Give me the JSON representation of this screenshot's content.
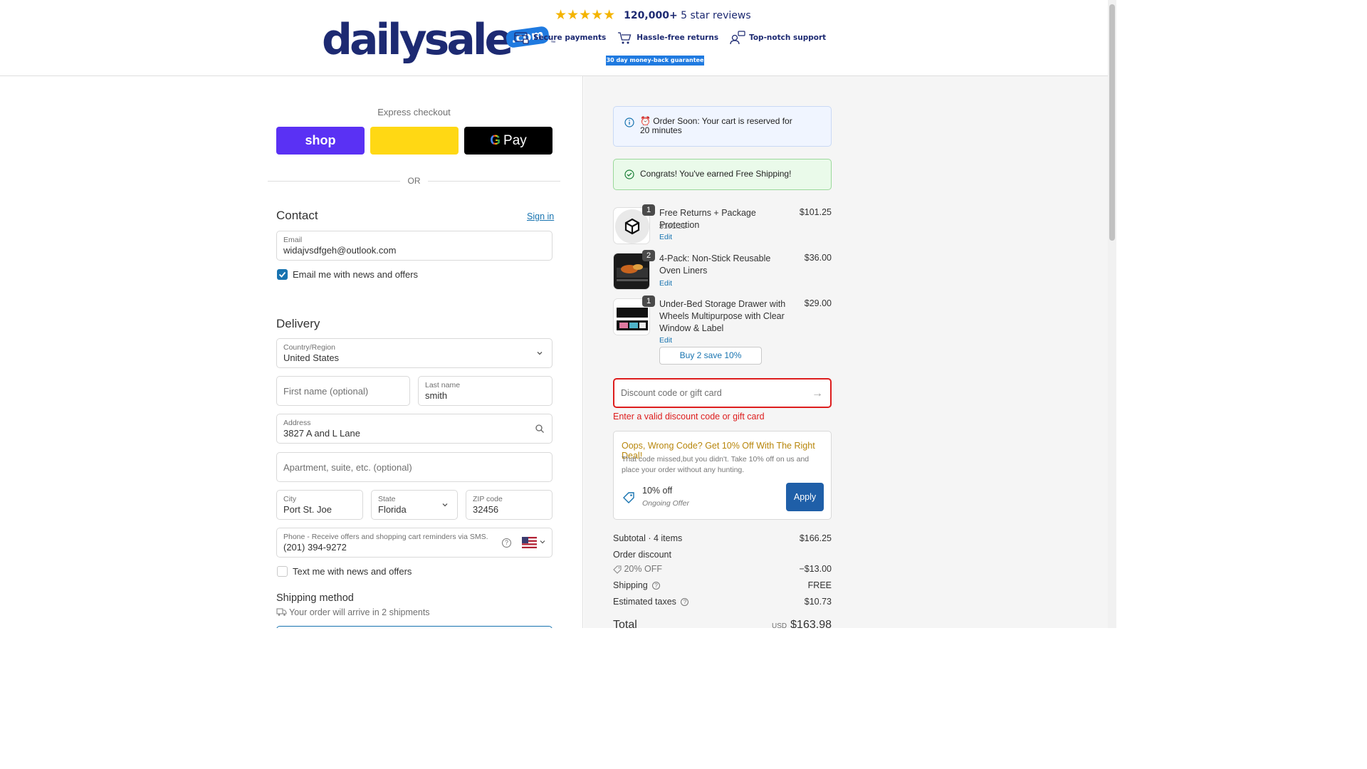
{
  "header": {
    "logo_word": "dailysale",
    "logo_dotcom": ".com",
    "logo_tm": "™",
    "stars": "★★★★★",
    "reviews_count": "120,000+",
    "reviews_label": "5 star reviews",
    "badges": [
      "Secure payments",
      "Hassle-free returns",
      "Top-notch support"
    ],
    "guarantee": "30 day money-back guarantee"
  },
  "express": {
    "label": "Express checkout",
    "shop_label": "shop",
    "gpay_label": "Pay",
    "or_label": "OR"
  },
  "contact": {
    "title": "Contact",
    "sign_in": "Sign in",
    "email_label": "Email",
    "email_value": "widajvsdfgeh@outlook.com",
    "news_label": "Email me with news and offers",
    "news_checked": true
  },
  "delivery": {
    "title": "Delivery",
    "country_label": "Country/Region",
    "country_value": "United States",
    "first_name_placeholder": "First name (optional)",
    "last_name_label": "Last name",
    "last_name_value": "smith",
    "address_label": "Address",
    "address_value": "3827 A and L Lane",
    "apartment_placeholder": "Apartment, suite, etc. (optional)",
    "city_label": "City",
    "city_value": "Port St. Joe",
    "state_label": "State",
    "state_value": "Florida",
    "zip_label": "ZIP code",
    "zip_value": "32456",
    "phone_label": "Phone - Receive offers and shopping cart reminders via SMS.",
    "phone_value": "(201) 394-9272",
    "text_label": "Text me with news and offers",
    "text_checked": false
  },
  "shipping": {
    "title": "Shipping method",
    "note": "Your order will arrive in 2 shipments"
  },
  "notices": {
    "reserve_icon": "⏰",
    "reserve_text": "Order Soon: Your cart is reserved for 20 minutes",
    "free_shipping": "Congrats! You've earned Free Shipping!"
  },
  "items": [
    {
      "qty": "1",
      "name": "Free Returns + Package Protection",
      "sub": "$101.25",
      "edit": "Edit",
      "price": "$101.25"
    },
    {
      "qty": "2",
      "name": "4-Pack: Non-Stick Reusable Oven Liners",
      "edit": "Edit",
      "price": "$36.00"
    },
    {
      "qty": "1",
      "name": "Under-Bed Storage Drawer with Wheels Multipurpose with Clear Window & Label",
      "edit": "Edit",
      "price": "$29.00"
    }
  ],
  "buy2": "Buy 2 save 10%",
  "discount": {
    "placeholder": "Discount code or gift card",
    "error": "Enter a valid discount code or gift card"
  },
  "deal": {
    "title": "Oops, Wrong Code? Get 10% Off With The Right Deal!",
    "body": "That code missed,but you didn't. Take 10% off on us and place your order without any hunting.",
    "offer": "10% off",
    "offer_sub": "Ongoing Offer",
    "apply": "Apply"
  },
  "summary": {
    "subtotal_label": "Subtotal · 4 items",
    "subtotal_value": "$166.25",
    "order_discount_label": "Order discount",
    "discount_code": "20% OFF",
    "discount_value": "−$13.00",
    "shipping_label": "Shipping",
    "shipping_value": "FREE",
    "taxes_label": "Estimated taxes",
    "taxes_value": "$10.73",
    "total_label": "Total",
    "currency": "USD",
    "total_value": "$163.98"
  }
}
